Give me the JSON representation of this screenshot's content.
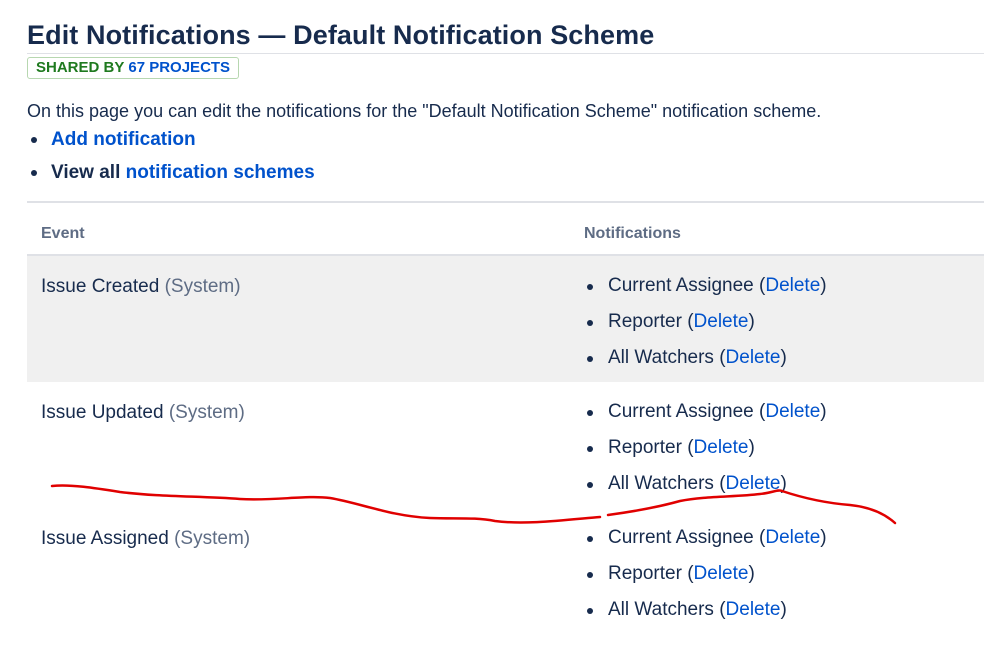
{
  "page": {
    "title": "Edit Notifications — Default Notification Scheme",
    "badge_prefix": "SHARED BY",
    "badge_link": "67 PROJECTS",
    "intro": "On this page you can edit the notifications for the \"Default Notification Scheme\" notification scheme."
  },
  "actions": {
    "add_notification": "Add notification",
    "view_all_prefix": "View all",
    "notification_schemes": "notification schemes"
  },
  "table": {
    "headers": {
      "event": "Event",
      "notifications": "Notifications"
    },
    "rows": [
      {
        "event": "Issue Created",
        "system_tag": "(System)",
        "notifications": [
          {
            "name": "Current Assignee",
            "action": "Delete"
          },
          {
            "name": "Reporter",
            "action": "Delete"
          },
          {
            "name": "All Watchers",
            "action": "Delete"
          }
        ]
      },
      {
        "event": "Issue Updated",
        "system_tag": "(System)",
        "notifications": [
          {
            "name": "Current Assignee",
            "action": "Delete"
          },
          {
            "name": "Reporter",
            "action": "Delete"
          },
          {
            "name": "All Watchers",
            "action": "Delete"
          }
        ]
      },
      {
        "event": "Issue Assigned",
        "system_tag": "(System)",
        "notifications": [
          {
            "name": "Current Assignee",
            "action": "Delete"
          },
          {
            "name": "Reporter",
            "action": "Delete"
          },
          {
            "name": "All Watchers",
            "action": "Delete"
          }
        ]
      }
    ]
  },
  "colors": {
    "link": "#0052cc",
    "heading": "#172b4d",
    "badge_green": "#1f7a1f",
    "shaded_row": "#f0f0f0",
    "annotation_stroke": "#e00000"
  },
  "annotation": {
    "type": "hand-drawn red line"
  }
}
